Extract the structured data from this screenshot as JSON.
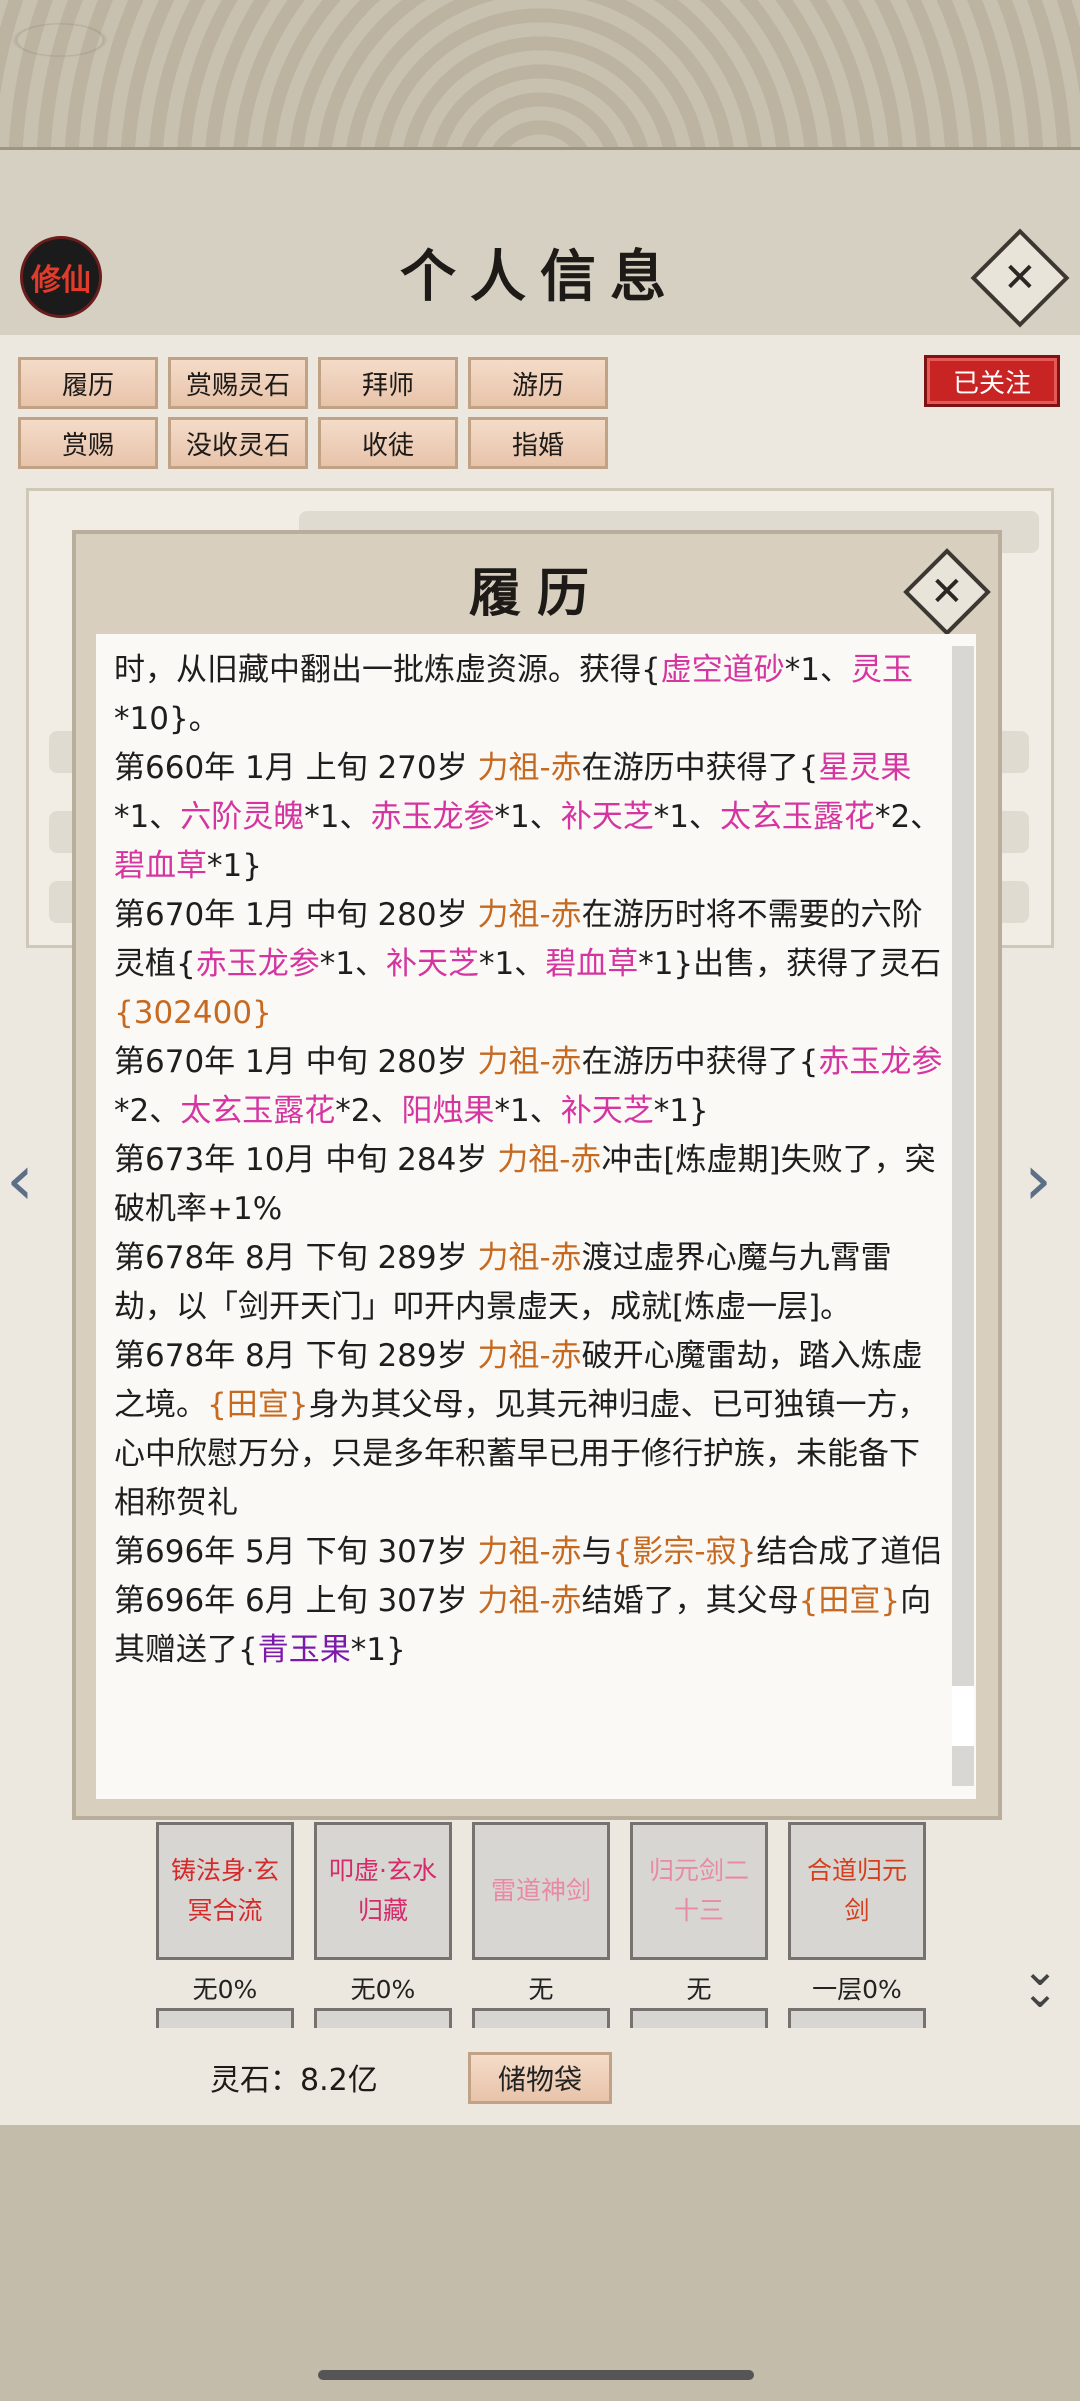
{
  "header": {
    "app_badge": "修仙",
    "title": "个人信息",
    "close_icon": "close-icon",
    "followed_label": "已关注"
  },
  "tabs": [
    {
      "label": "履历"
    },
    {
      "label": "赏赐灵石"
    },
    {
      "label": "拜师"
    },
    {
      "label": "游历"
    },
    {
      "label": "赏赐"
    },
    {
      "label": "没收灵石"
    },
    {
      "label": "收徒"
    },
    {
      "label": "指婚"
    }
  ],
  "modal": {
    "title": "履历",
    "close_icon": "close-icon",
    "entries": [
      [
        {
          "t": "时，从旧藏中翻出一批炼虚资源。获得{",
          "c": ""
        },
        {
          "t": "虚空道砂",
          "c": "pink"
        },
        {
          "t": "*1、",
          "c": ""
        },
        {
          "t": "灵玉",
          "c": "pink"
        },
        {
          "t": "*10}。",
          "c": ""
        }
      ],
      [
        {
          "t": "第660年 1月 上旬 270岁 ",
          "c": ""
        },
        {
          "t": "力祖-赤",
          "c": "orange"
        },
        {
          "t": "在游历中获得了{",
          "c": ""
        },
        {
          "t": "星灵果",
          "c": "pink"
        },
        {
          "t": "*1、",
          "c": ""
        },
        {
          "t": "六阶灵魄",
          "c": "pink"
        },
        {
          "t": "*1、",
          "c": ""
        },
        {
          "t": "赤玉龙参",
          "c": "pink"
        },
        {
          "t": "*1、",
          "c": ""
        },
        {
          "t": "补天芝",
          "c": "pink"
        },
        {
          "t": "*1、",
          "c": ""
        },
        {
          "t": "太玄玉露花",
          "c": "pink"
        },
        {
          "t": "*2、",
          "c": ""
        },
        {
          "t": "碧血草",
          "c": "pink"
        },
        {
          "t": "*1}",
          "c": ""
        }
      ],
      [
        {
          "t": "第670年 1月 中旬 280岁 ",
          "c": ""
        },
        {
          "t": "力祖-赤",
          "c": "orange"
        },
        {
          "t": "在游历时将不需要的六阶灵植{",
          "c": ""
        },
        {
          "t": "赤玉龙参",
          "c": "pink"
        },
        {
          "t": "*1、",
          "c": ""
        },
        {
          "t": "补天芝",
          "c": "pink"
        },
        {
          "t": "*1、",
          "c": ""
        },
        {
          "t": "碧血草",
          "c": "pink"
        },
        {
          "t": "*1}出售，获得了灵石",
          "c": ""
        },
        {
          "t": "{302400}",
          "c": "orange"
        }
      ],
      [
        {
          "t": "第670年 1月 中旬 280岁 ",
          "c": ""
        },
        {
          "t": "力祖-赤",
          "c": "orange"
        },
        {
          "t": "在游历中获得了{",
          "c": ""
        },
        {
          "t": "赤玉龙参",
          "c": "pink"
        },
        {
          "t": "*2、",
          "c": ""
        },
        {
          "t": "太玄玉露花",
          "c": "pink"
        },
        {
          "t": "*2、",
          "c": ""
        },
        {
          "t": "阳烛果",
          "c": "pink"
        },
        {
          "t": "*1、",
          "c": ""
        },
        {
          "t": "补天芝",
          "c": "pink"
        },
        {
          "t": "*1}",
          "c": ""
        }
      ],
      [
        {
          "t": "第673年 10月 中旬  284岁  ",
          "c": ""
        },
        {
          "t": "力祖-赤",
          "c": "orange"
        },
        {
          "t": "冲击[炼虚期]失败了，突破机率+1%",
          "c": ""
        }
      ],
      [
        {
          "t": "第678年 8月 下旬  289岁 ",
          "c": ""
        },
        {
          "t": "力祖-赤",
          "c": "orange"
        },
        {
          "t": "渡过虚界心魔与九霄雷劫，以「剑开天门」叩开内景虚天，成就[炼虚一层]。",
          "c": ""
        }
      ],
      [
        {
          "t": "第678年 8月 下旬 289岁 ",
          "c": ""
        },
        {
          "t": "力祖-赤",
          "c": "orange"
        },
        {
          "t": "破开心魔雷劫，踏入炼虚之境。",
          "c": ""
        },
        {
          "t": "{田宣}",
          "c": "orange"
        },
        {
          "t": "身为其父母，见其元神归虚、已可独镇一方，心中欣慰万分，只是多年积蓄早已用于修行护族，未能备下相称贺礼",
          "c": ""
        }
      ],
      [
        {
          "t": "第696年 5月 下旬 307岁 ",
          "c": ""
        },
        {
          "t": "力祖-赤",
          "c": "orange"
        },
        {
          "t": "与",
          "c": ""
        },
        {
          "t": "{影宗-寂}",
          "c": "orange"
        },
        {
          "t": "结合成了道侣",
          "c": ""
        }
      ],
      [
        {
          "t": "第696年 6月 上旬  307岁  ",
          "c": ""
        },
        {
          "t": "力祖-赤",
          "c": "orange"
        },
        {
          "t": "结婚了，其父母",
          "c": ""
        },
        {
          "t": "{田宣}",
          "c": "orange"
        },
        {
          "t": "向其赠送了{",
          "c": ""
        },
        {
          "t": "青玉果",
          "c": "purple"
        },
        {
          "t": "*1}",
          "c": ""
        }
      ]
    ]
  },
  "skills": [
    {
      "name": "铸法身·玄冥合流",
      "level": "无0%",
      "color": "#d62a2a"
    },
    {
      "name": "叩虚·玄水归藏",
      "level": "无0%",
      "color": "#d62a6a"
    },
    {
      "name": "雷道神剑",
      "level": "无",
      "color": "#e98aa5"
    },
    {
      "name": "归元剑二十三",
      "level": "无",
      "color": "#e98aa5"
    },
    {
      "name": "合道归元剑",
      "level": "一层0%",
      "color": "#d4401e"
    }
  ],
  "footer": {
    "stones": "灵石：8.2亿",
    "bag_label": "储物袋"
  },
  "colors": {
    "orange": "#c66a22",
    "pink": "#d535a0",
    "purple": "#7b1aa8",
    "accent_red": "#c82424"
  }
}
